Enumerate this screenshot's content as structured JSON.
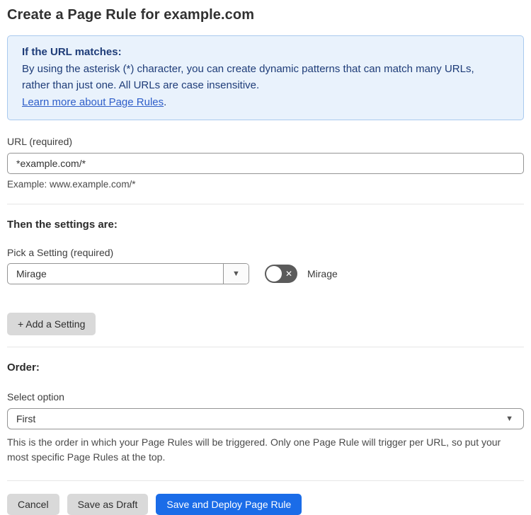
{
  "page": {
    "title": "Create a Page Rule for example.com"
  },
  "info_box": {
    "heading": "If the URL matches:",
    "body": "By using the asterisk (*) character, you can create dynamic patterns that can match many URLs, rather than just one. All URLs are case insensitive.",
    "link_label": "Learn more about Page Rules",
    "link_suffix": "."
  },
  "url_field": {
    "label": "URL (required)",
    "value": "*example.com/*",
    "example": "Example: www.example.com/*"
  },
  "settings": {
    "heading": "Then the settings are:",
    "picker_label": "Pick a Setting (required)",
    "selected_setting": "Mirage",
    "toggle": {
      "label": "Mirage",
      "state": "off",
      "off_icon": "✕"
    },
    "add_button_label": "+ Add a Setting"
  },
  "order": {
    "heading": "Order:",
    "select_label": "Select option",
    "selected_option": "First",
    "help_text": "This is the order in which your Page Rules will be triggered. Only one Page Rule will trigger per URL, so put your most specific Page Rules at the top."
  },
  "footer": {
    "cancel_label": "Cancel",
    "save_draft_label": "Save as Draft",
    "save_deploy_label": "Save and Deploy Page Rule"
  },
  "colors": {
    "primary_button": "#1a6ce8",
    "info_background": "#e9f2fc",
    "info_border": "#a9c9ee",
    "info_text": "#1e3c78",
    "link": "#2e5ec9",
    "toggle_off": "#5b5b5b"
  },
  "icons": {
    "select_caret": "▼"
  }
}
